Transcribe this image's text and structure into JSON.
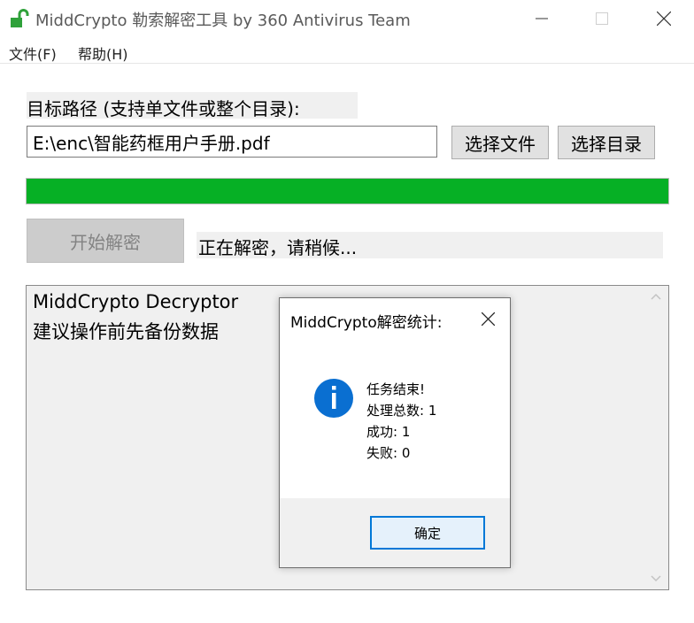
{
  "window": {
    "title": "MiddCrypto 勒索解密工具 by 360 Antivirus Team",
    "icon": "open-padlock-icon"
  },
  "menu": {
    "items": [
      {
        "label": "文件(F)"
      },
      {
        "label": "帮助(H)"
      }
    ]
  },
  "main": {
    "path_label": "目标路径 (支持单文件或整个目录):",
    "path_value": "E:\\enc\\智能药框用户手册.pdf",
    "select_file_label": "选择文件",
    "select_dir_label": "选择目录",
    "progress_percent": 100,
    "start_label": "开始解密",
    "status_text": "正在解密，请稍候...",
    "log_lines": [
      "MiddCrypto Decryptor",
      "建议操作前先备份数据"
    ]
  },
  "dialog": {
    "title": "MiddCrypto解密统计:",
    "icon": "info-icon",
    "messages": [
      "任务结束!",
      "处理总数: 1",
      "成功: 1",
      "失败: 0"
    ],
    "ok_label": "确定"
  },
  "colors": {
    "progress": "#06b025",
    "info_icon": "#0a6fd1",
    "focus_border": "#0078d7",
    "app_icon": "#2fa13a"
  }
}
